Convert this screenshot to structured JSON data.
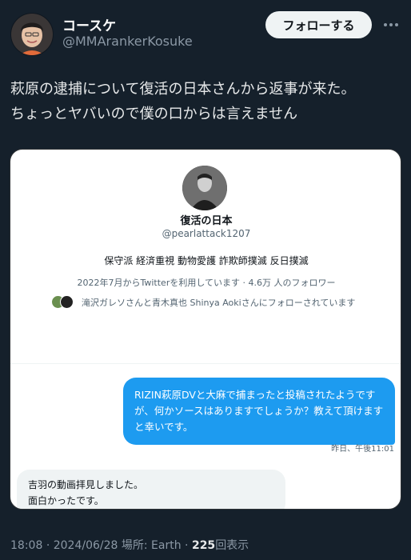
{
  "header": {
    "name": "コースケ",
    "handle": "@MMArankerKosuke",
    "follow_label": "フォローする",
    "more_icon": "more-horizontal-icon"
  },
  "tweet": {
    "lines": [
      "萩原の逮捕について復活の日本さんから返事が来た。",
      "ちょっとヤバいので僕の口からは言えません"
    ]
  },
  "media": {
    "profile": {
      "name": "復活の日本",
      "handle": "@pearlattack1207",
      "bio": "保守派 経済重視 動物愛護 詐欺師撲滅 反日撲滅",
      "stats": "2022年7月からTwitterを利用しています · 4.6万 人のフォロワー",
      "followed_by": "滝沢ガレソさんと青木真也 Shinya Aokiさんにフォローされています"
    },
    "outgoing": {
      "text": "RIZIN萩原DVと大麻で捕まったと投稿されたようですが、何かソースはありますでしょうか？教えて頂けますと幸いです。",
      "time": "昨日、午後11:01"
    },
    "incoming": {
      "lines": [
        "吉羽の動画拝見しました。",
        "面白かったです。"
      ]
    }
  },
  "meta": {
    "time": "18:08",
    "date": "2024/06/28",
    "location_label": "場所: Earth",
    "views_count": "225",
    "views_label": "回表示",
    "sep": "·"
  },
  "colors": {
    "background": "#15202b",
    "accent": "#1d9bf0",
    "muted": "#8b98a5"
  }
}
